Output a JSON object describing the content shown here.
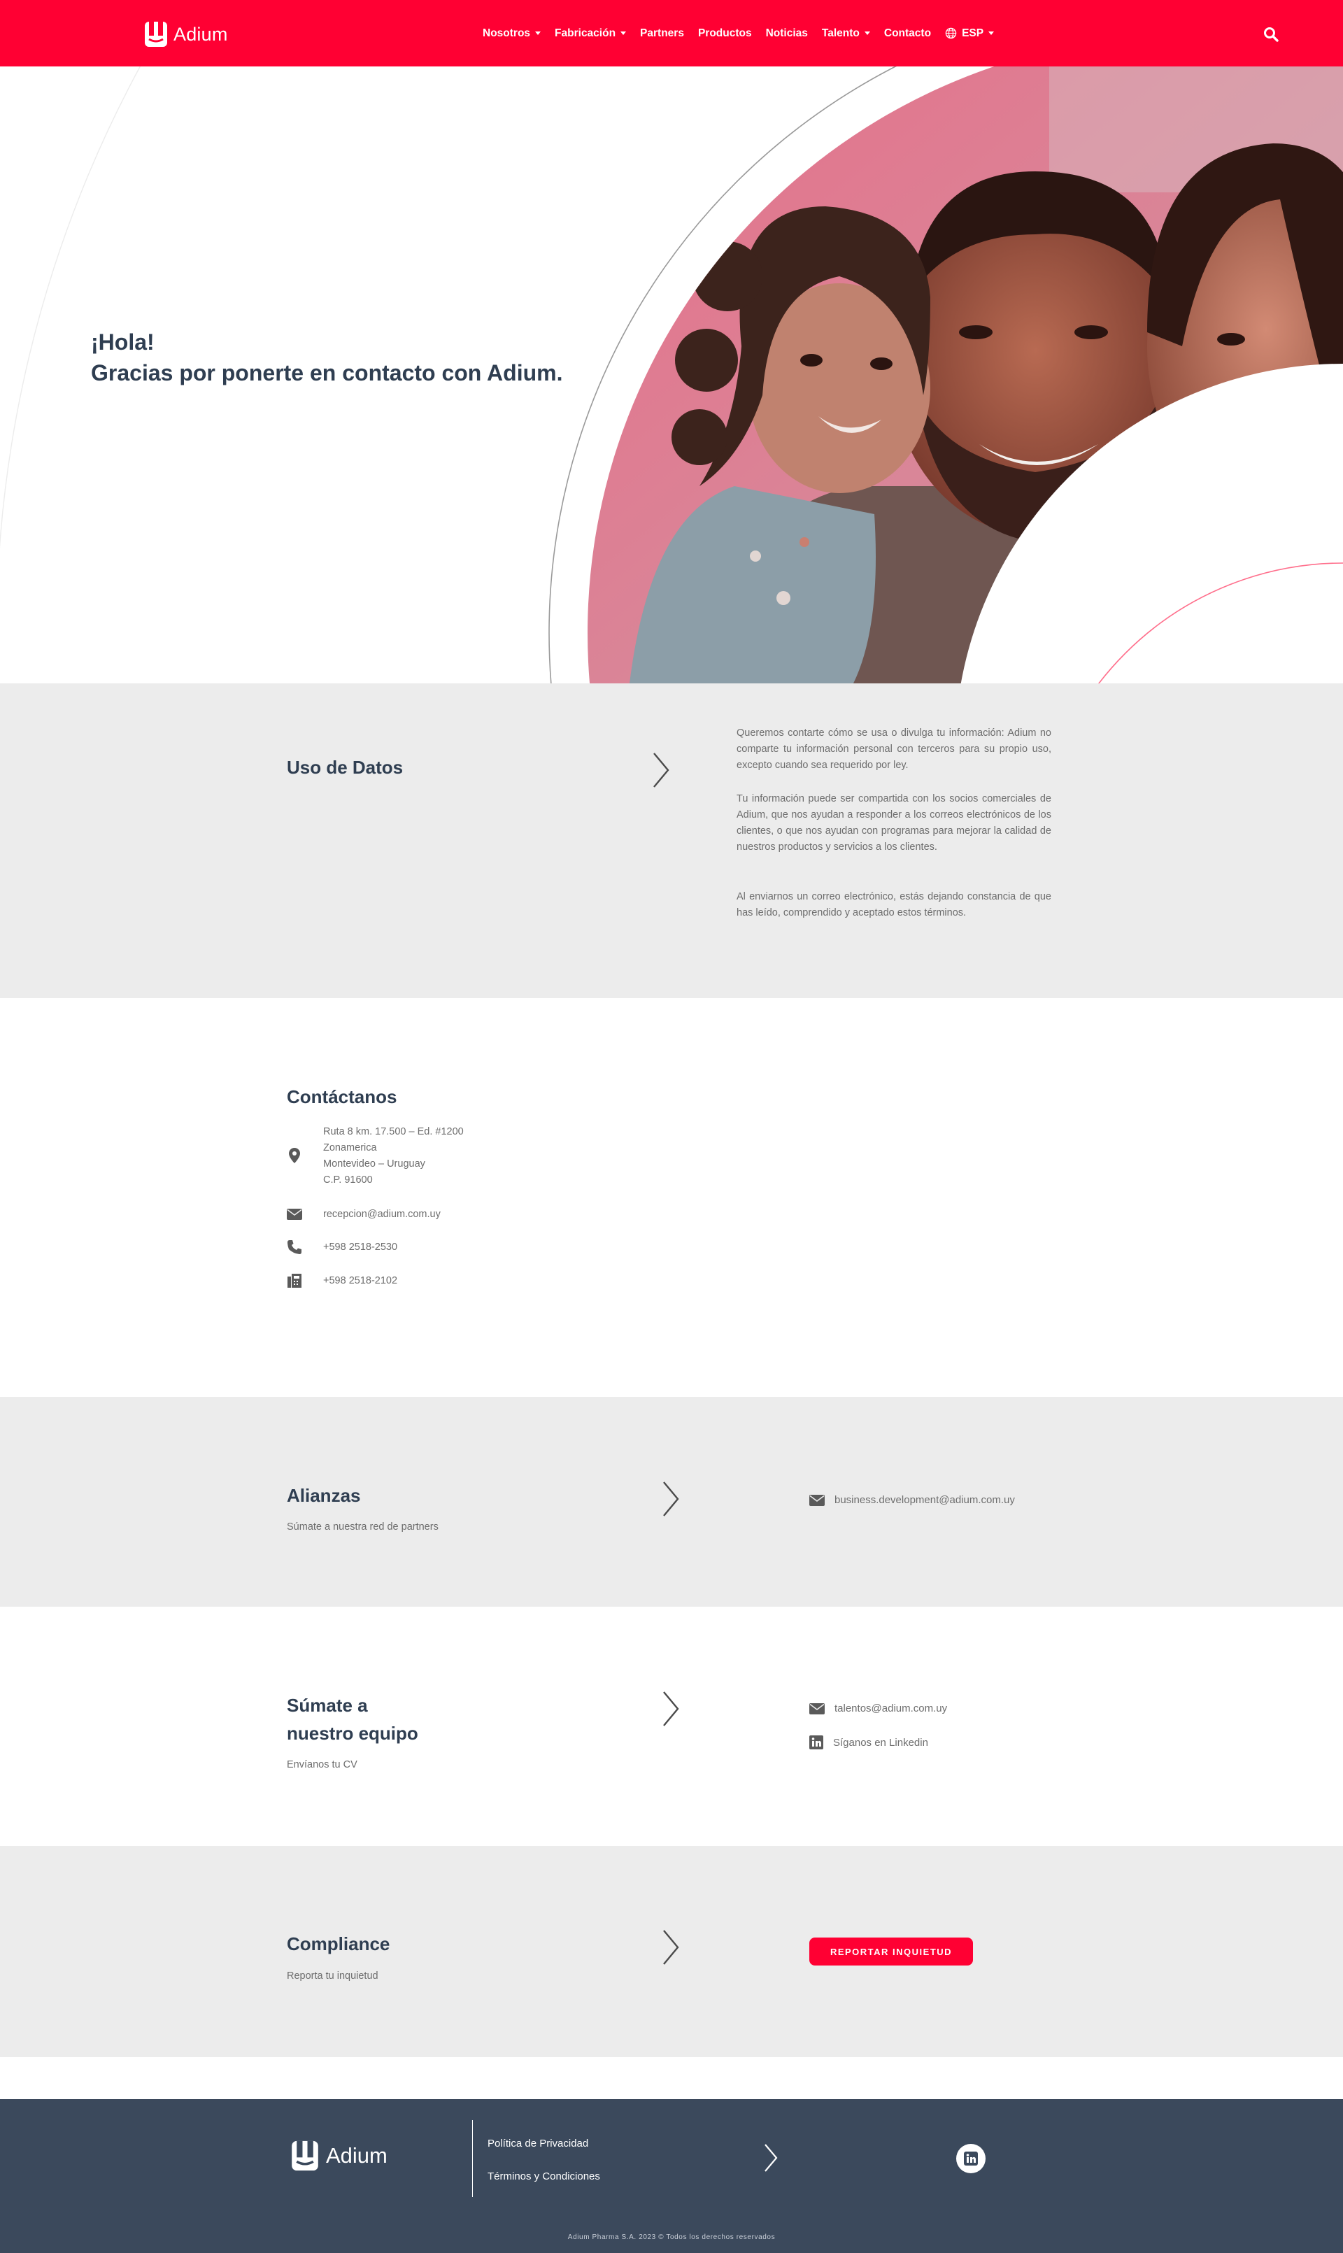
{
  "header": {
    "brand": "Adium",
    "nav": [
      {
        "label": "Nosotros",
        "dropdown": true
      },
      {
        "label": "Fabricación",
        "dropdown": true
      },
      {
        "label": "Partners",
        "dropdown": false
      },
      {
        "label": "Productos",
        "dropdown": false
      },
      {
        "label": "Noticias",
        "dropdown": false
      },
      {
        "label": "Talento",
        "dropdown": true
      },
      {
        "label": "Contacto",
        "dropdown": false
      }
    ],
    "language": "ESP",
    "accent_color": "#ff0033"
  },
  "hero": {
    "line1": "¡Hola!",
    "line2": "Gracias por ponerte en contacto con Adium."
  },
  "uso_datos": {
    "title": "Uso de Datos",
    "paragraphs": [
      "Queremos contarte cómo se usa o divulga tu información: Adium no comparte tu información personal con terceros para su propio uso, excepto cuando sea requerido por ley.",
      "Tu información puede ser compartida con los socios comerciales de Adium, que nos ayudan a responder a los correos electrónicos de los clientes, o que nos ayudan con programas para mejorar la calidad de nuestros productos y servicios a los clientes.",
      "Al enviarnos un correo electrónico, estás dejando constancia de que has leído, comprendido y aceptado estos términos."
    ]
  },
  "contacto": {
    "title": "Contáctanos",
    "address": [
      "Ruta 8 km. 17.500 – Ed. #1200",
      "Zonamerica",
      "Montevideo – Uruguay",
      "C.P. 91600"
    ],
    "email": "recepcion@adium.com.uy",
    "phone": "+598 2518-2530",
    "fax": "+598 2518-2102"
  },
  "alianzas": {
    "title": "Alianzas",
    "subtitle": "Súmate a nuestra red de partners",
    "email": "business.development@adium.com.uy"
  },
  "talento": {
    "title_line1": "Súmate a",
    "title_line2": "nuestro equipo",
    "subtitle": "Envíanos tu CV",
    "email": "talentos@adium.com.uy",
    "linkedin": "Síganos en Linkedin"
  },
  "compliance": {
    "title": "Compliance",
    "subtitle": "Reporta tu inquietud",
    "button": "REPORTAR INQUIETUD"
  },
  "footer": {
    "brand": "Adium",
    "links": [
      "Política de Privacidad",
      "Términos y Condiciones"
    ],
    "copyright": "Adium Pharma S.A. 2023 © Todos los derechos reservados"
  }
}
